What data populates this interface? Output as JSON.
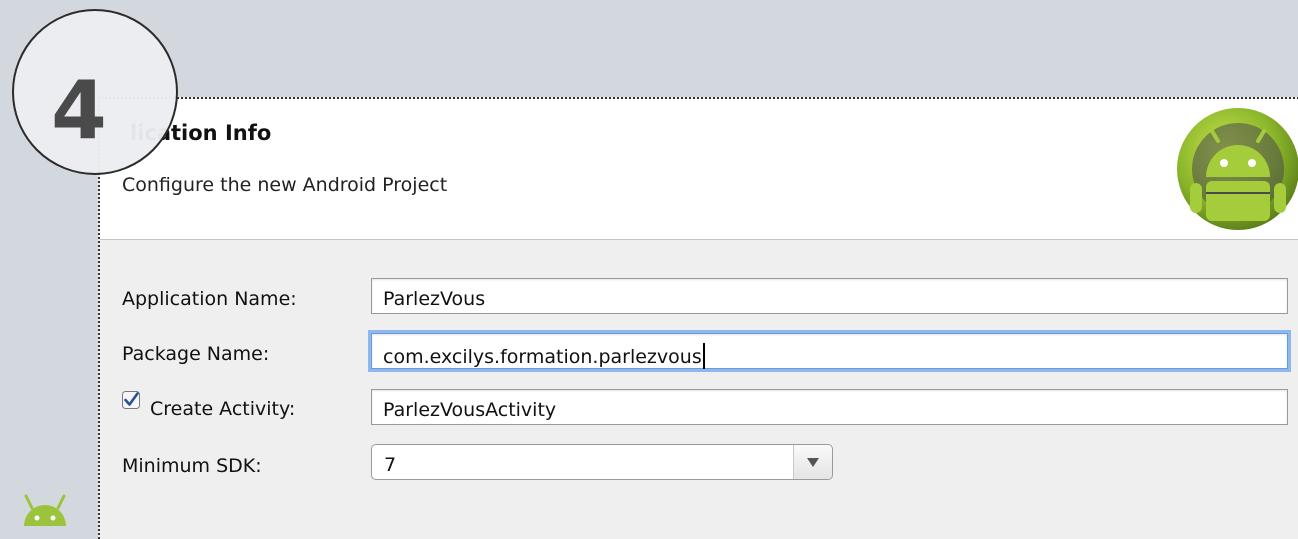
{
  "step": {
    "number": "4"
  },
  "wizard": {
    "title": "lication Info",
    "subtitle": "Configure the new Android Project"
  },
  "form": {
    "application_name": {
      "label": "Application Name:",
      "value": "ParlezVous"
    },
    "package_name": {
      "label": "Package Name:",
      "value": "com.excilys.formation.parlezvous"
    },
    "create_activity": {
      "label": "Create Activity:",
      "checked": true,
      "value": "ParlezVousActivity"
    },
    "minimum_sdk": {
      "label": "Minimum SDK:",
      "value": "7"
    }
  },
  "icons": {
    "header_logo": "android-logo-icon",
    "checkbox": "checkbox-checked-icon",
    "dropdown": "chevron-down-icon",
    "corner": "android-robot-icon"
  },
  "colors": {
    "background": "#d3d8df",
    "android_green": "#9bc33c",
    "focus_ring": "#8fb8ef"
  }
}
